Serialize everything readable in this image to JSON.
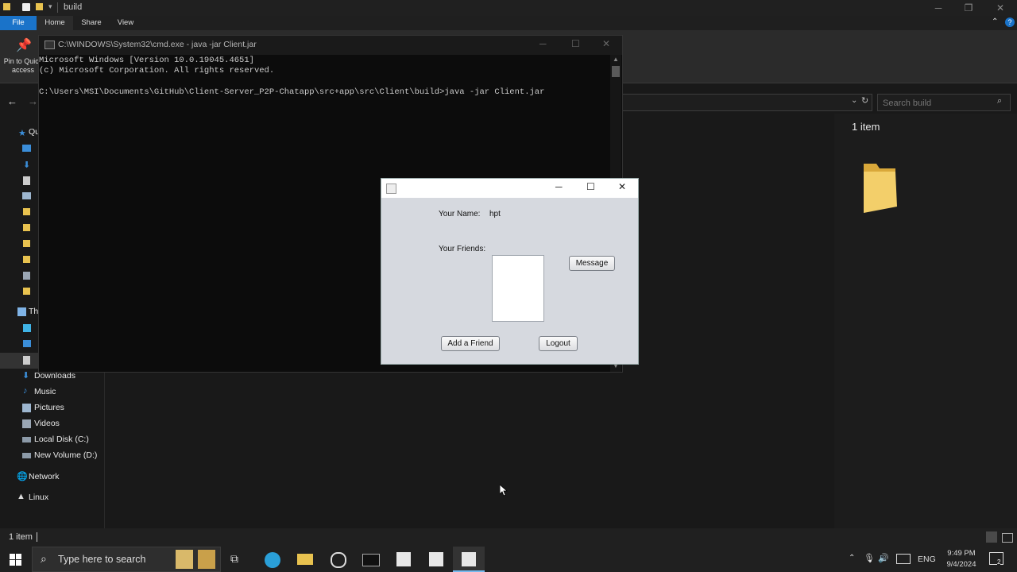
{
  "explorer": {
    "title": "build",
    "tabs": {
      "file": "File",
      "home": "Home",
      "share": "Share",
      "view": "View"
    },
    "pin_label": "Pin to Quick access",
    "search_placeholder": "Search build",
    "item_count": "1 item",
    "nav": {
      "quick_access": "Qu",
      "this_pc": "Thi",
      "downloads": "Downloads",
      "music": "Music",
      "pictures": "Pictures",
      "videos": "Videos",
      "local_disk": "Local Disk (C:)",
      "new_volume": "New Volume (D:)",
      "network": "Network",
      "linux": "Linux"
    },
    "status": "1 item"
  },
  "cmd": {
    "title": "C:\\WINDOWS\\System32\\cmd.exe - java  -jar Client.jar",
    "lines": [
      "Microsoft Windows [Version 10.0.19045.4651]",
      "(c) Microsoft Corporation. All rights reserved.",
      "",
      "C:\\Users\\MSI\\Documents\\GitHub\\Client-Server_P2P-Chatapp\\src+app\\src\\Client\\build>java -jar Client.jar"
    ]
  },
  "dialog": {
    "name_label": "Your Name:",
    "name_value": "hpt",
    "friends_label": "Your Friends:",
    "message_button": "Message",
    "add_friend_button": "Add a Friend",
    "logout_button": "Logout"
  },
  "taskbar": {
    "search_placeholder": "Type here to search",
    "lang": "ENG",
    "time": "9:49 PM",
    "date": "9/4/2024",
    "notification_count": "2"
  },
  "colors": {
    "explorer_bg": "#191919",
    "file_tab": "#1a73c9",
    "dialog_bg": "#d6d9df",
    "taskbar_bg": "#202020"
  }
}
